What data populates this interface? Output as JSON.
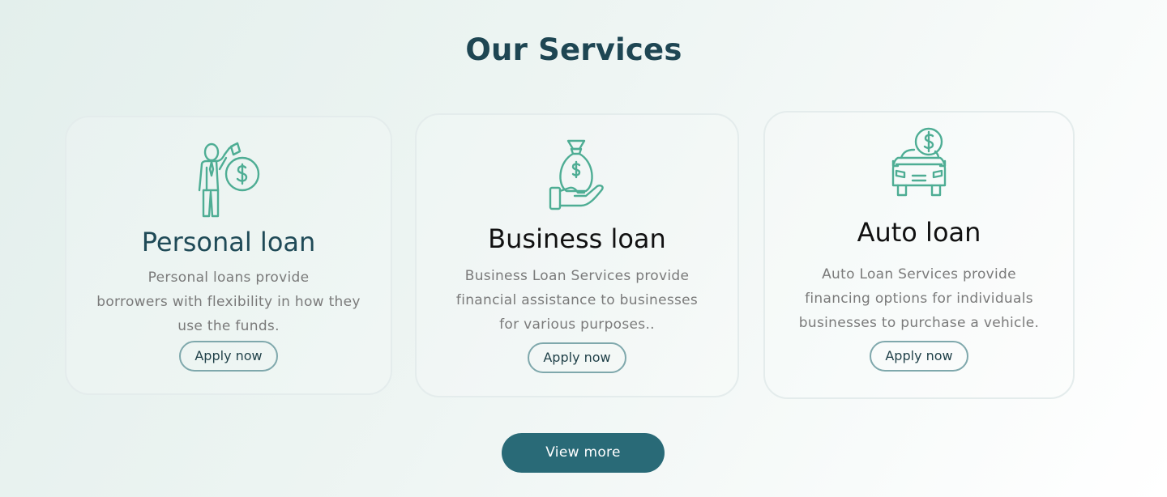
{
  "section": {
    "title": "Our Services"
  },
  "accent_color": "#4ead94",
  "services": [
    {
      "icon": "businessman-money-bag-icon",
      "title": "Personal loan",
      "description_lines": [
        "Personal loans provide",
        "borrowers with flexibility in how they",
        "use the funds."
      ],
      "button_label": "Apply now"
    },
    {
      "icon": "hand-money-bag-icon",
      "title": "Business loan",
      "description_lines": [
        "Business Loan Services provide",
        "financial assistance to businesses",
        "for various purposes.."
      ],
      "button_label": "Apply now"
    },
    {
      "icon": "car-dollar-icon",
      "title": "Auto loan",
      "description_lines": [
        "Auto Loan Services provide",
        "financing options for individuals",
        "businesses to purchase a vehicle."
      ],
      "button_label": "Apply now"
    }
  ],
  "view_more": {
    "label": "View more",
    "color": "#296a77"
  }
}
